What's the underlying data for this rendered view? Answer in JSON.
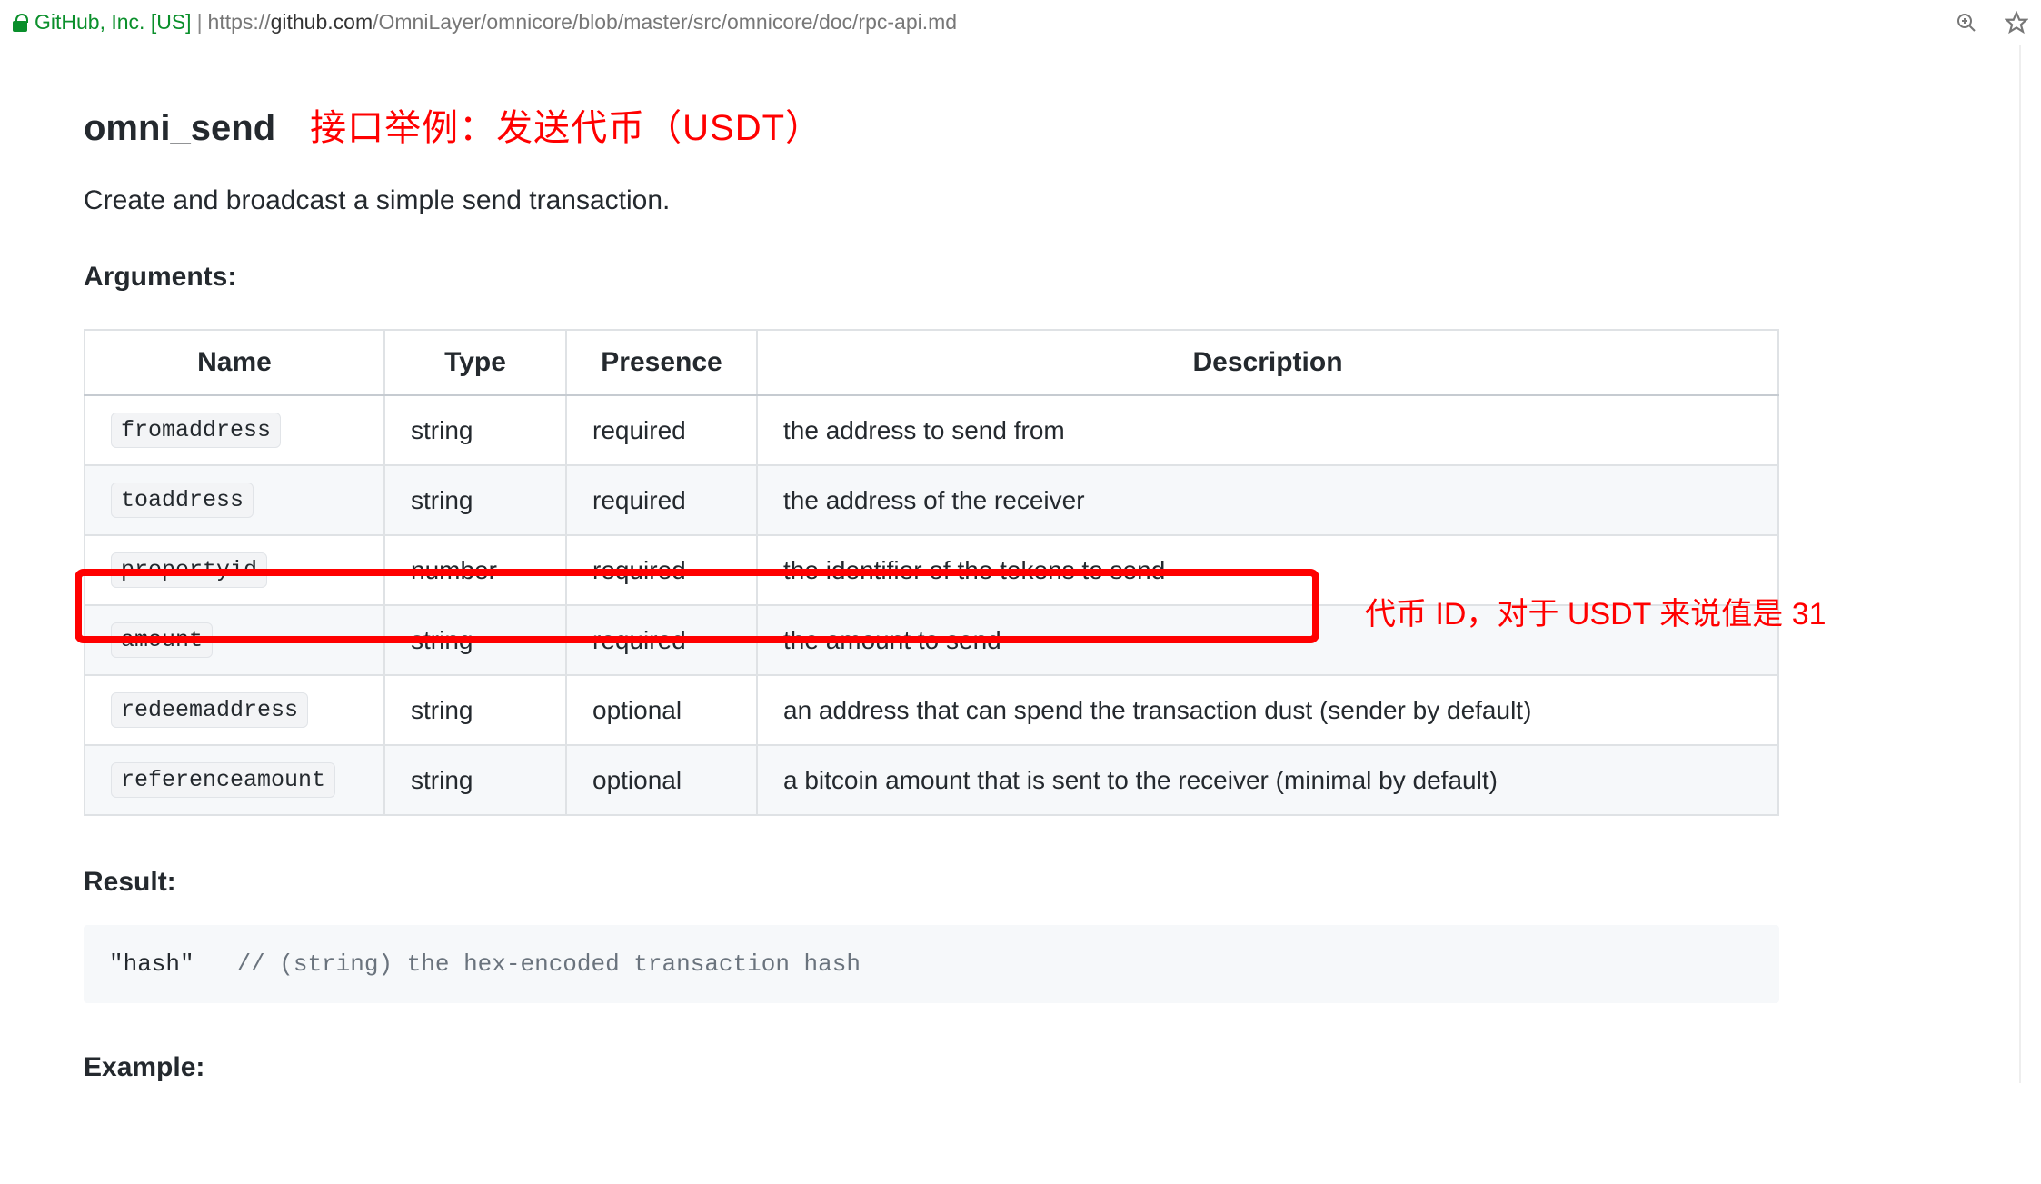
{
  "browser": {
    "site_identity": "GitHub, Inc. [US]",
    "url_scheme": "https://",
    "url_host": "github.com",
    "url_path": "/OmniLayer/omnicore/blob/master/src/omnicore/doc/rpc-api.md",
    "zoom_icon": "zoom",
    "star_icon": "star"
  },
  "doc": {
    "api_name": "omni_send",
    "heading_annotation": "接口举例：发送代币（USDT）",
    "lead": "Create and broadcast a simple send transaction.",
    "arguments_label": "Arguments:",
    "result_label": "Result:",
    "example_label": "Example:",
    "columns": {
      "name": "Name",
      "type": "Type",
      "presence": "Presence",
      "description": "Description"
    },
    "args": [
      {
        "name": "fromaddress",
        "type": "string",
        "presence": "required",
        "description": "the address to send from"
      },
      {
        "name": "toaddress",
        "type": "string",
        "presence": "required",
        "description": "the address of the receiver"
      },
      {
        "name": "propertyid",
        "type": "number",
        "presence": "required",
        "description": "the identifier of the tokens to send"
      },
      {
        "name": "amount",
        "type": "string",
        "presence": "required",
        "description": "the amount to send"
      },
      {
        "name": "redeemaddress",
        "type": "string",
        "presence": "optional",
        "description": "an address that can spend the transaction dust (sender by default)"
      },
      {
        "name": "referenceamount",
        "type": "string",
        "presence": "optional",
        "description": "a bitcoin amount that is sent to the receiver (minimal by default)"
      }
    ],
    "side_annotation": "代币 ID，对于 USDT 来说值是 31",
    "result_code_key": "\"hash\"",
    "result_code_comment": "// (string) the hex-encoded transaction hash"
  }
}
